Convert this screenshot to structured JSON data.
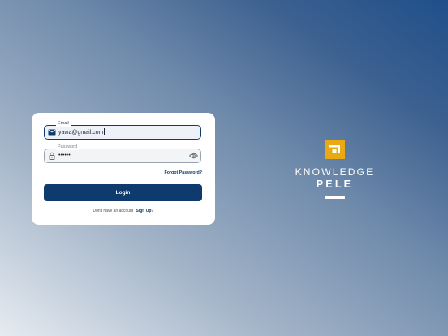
{
  "login_form": {
    "email_label": "Email",
    "email_value": "yawa@gmail.com",
    "password_label": "Password",
    "password_value": "••••••",
    "forgot_password": "Forgot Password?",
    "login_button": "Login",
    "no_account_text": "Don't have an account",
    "sign_up_link": "Sign Up?"
  },
  "brand": {
    "name_line_1": "KNOWLEDGE",
    "name_line_2": "PELE",
    "logo_color": "#e8a913"
  },
  "colors": {
    "primary": "#0f3a6e",
    "card_background": "#ffffff"
  }
}
